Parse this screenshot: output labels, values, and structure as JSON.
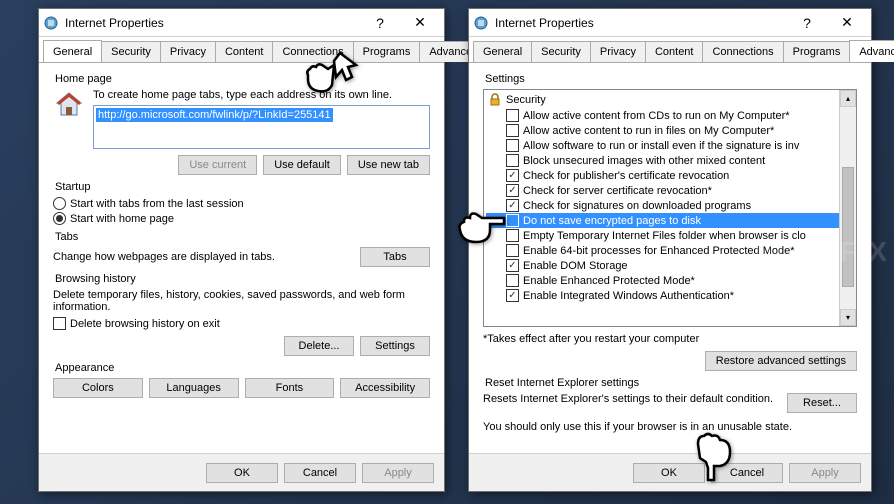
{
  "watermark": "UGETFIX",
  "leftDialog": {
    "title": "Internet Properties",
    "tabs": [
      "General",
      "Security",
      "Privacy",
      "Content",
      "Connections",
      "Programs",
      "Advanced"
    ],
    "activeTab": 0,
    "homepage": {
      "groupTitle": "Home page",
      "instruction": "To create home page tabs, type each address on its own line.",
      "url": "http://go.microsoft.com/fwlink/p/?LinkId=255141",
      "useCurrent": "Use current",
      "useDefault": "Use default",
      "useNewTab": "Use new tab"
    },
    "startup": {
      "groupTitle": "Startup",
      "opt1": "Start with tabs from the last session",
      "opt2": "Start with home page",
      "selected": 1
    },
    "tabsSection": {
      "groupTitle": "Tabs",
      "text": "Change how webpages are displayed in tabs.",
      "btn": "Tabs"
    },
    "history": {
      "groupTitle": "Browsing history",
      "text": "Delete temporary files, history, cookies, saved passwords, and web form information.",
      "checkLabel": "Delete browsing history on exit",
      "deleteBtn": "Delete...",
      "settingsBtn": "Settings"
    },
    "appearance": {
      "groupTitle": "Appearance",
      "colors": "Colors",
      "languages": "Languages",
      "fonts": "Fonts",
      "accessibility": "Accessibility"
    }
  },
  "rightDialog": {
    "title": "Internet Properties",
    "tabs": [
      "General",
      "Security",
      "Privacy",
      "Content",
      "Connections",
      "Programs",
      "Advanced"
    ],
    "activeTab": 6,
    "settings": {
      "groupTitle": "Settings",
      "securityHeader": "Security",
      "items": [
        {
          "label": "Allow active content from CDs to run on My Computer*",
          "checked": false
        },
        {
          "label": "Allow active content to run in files on My Computer*",
          "checked": false
        },
        {
          "label": "Allow software to run or install even if the signature is inv",
          "checked": false
        },
        {
          "label": "Block unsecured images with other mixed content",
          "checked": false
        },
        {
          "label": "Check for publisher's certificate revocation",
          "checked": true
        },
        {
          "label": "Check for server certificate revocation*",
          "checked": true
        },
        {
          "label": "Check for signatures on downloaded programs",
          "checked": true
        },
        {
          "label": "Do not save encrypted pages to disk",
          "checked": false,
          "selected": true
        },
        {
          "label": "Empty Temporary Internet Files folder when browser is clo",
          "checked": false
        },
        {
          "label": "Enable 64-bit processes for Enhanced Protected Mode*",
          "checked": false
        },
        {
          "label": "Enable DOM Storage",
          "checked": true
        },
        {
          "label": "Enable Enhanced Protected Mode*",
          "checked": false
        },
        {
          "label": "Enable Integrated Windows Authentication*",
          "checked": true
        }
      ],
      "note": "*Takes effect after you restart your computer",
      "restoreBtn": "Restore advanced settings"
    },
    "reset": {
      "groupTitle": "Reset Internet Explorer settings",
      "text": "Resets Internet Explorer's settings to their default condition.",
      "btn": "Reset...",
      "warning": "You should only use this if your browser is in an unusable state."
    }
  },
  "footer": {
    "ok": "OK",
    "cancel": "Cancel",
    "apply": "Apply"
  }
}
